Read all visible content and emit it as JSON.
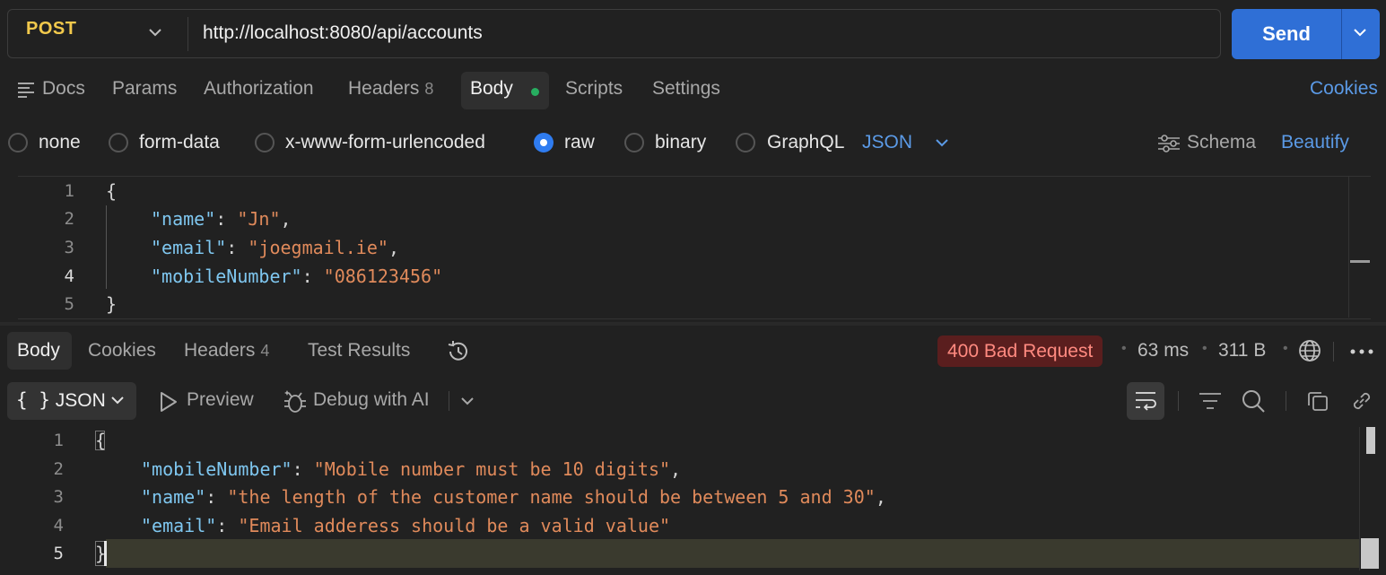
{
  "request": {
    "method": "POST",
    "url": "http://localhost:8080/api/accounts",
    "send_label": "Send"
  },
  "request_tabs": {
    "docs": "Docs",
    "params": "Params",
    "authorization": "Authorization",
    "headers": "Headers",
    "headers_count": "8",
    "body": "Body",
    "scripts": "Scripts",
    "settings": "Settings",
    "cookies": "Cookies"
  },
  "body_types": {
    "none": "none",
    "form_data": "form-data",
    "urlencoded": "x-www-form-urlencoded",
    "raw": "raw",
    "binary": "binary",
    "graphql": "GraphQL",
    "selected": "raw",
    "format": "JSON",
    "schema": "Schema",
    "beautify": "Beautify"
  },
  "request_body": {
    "line_numbers": [
      "1",
      "2",
      "3",
      "4",
      "5"
    ],
    "open": "{",
    "close": "}",
    "fields": [
      {
        "key": "\"name\"",
        "value": "\"Jn\"",
        "trail": ","
      },
      {
        "key": "\"email\"",
        "value": "\"joegmail.ie\"",
        "trail": ","
      },
      {
        "key": "\"mobileNumber\"",
        "value": "\"086123456\"",
        "trail": ""
      }
    ]
  },
  "response_tabs": {
    "body": "Body",
    "cookies": "Cookies",
    "headers": "Headers",
    "headers_count": "4",
    "test_results": "Test Results"
  },
  "response_meta": {
    "status": "400 Bad Request",
    "time": "63 ms",
    "size": "311 B"
  },
  "response_toolbar": {
    "format": "JSON",
    "preview": "Preview",
    "debug": "Debug with AI"
  },
  "response_body": {
    "line_numbers": [
      "1",
      "2",
      "3",
      "4",
      "5"
    ],
    "open": "{",
    "close": "}",
    "fields": [
      {
        "key": "\"mobileNumber\"",
        "value": "\"Mobile number must be 10 digits\"",
        "trail": ","
      },
      {
        "key": "\"name\"",
        "value": "\"the length of the customer name should be between 5 and 30\"",
        "trail": ","
      },
      {
        "key": "\"email\"",
        "value": "\"Email adderess should be a valid value\"",
        "trail": ""
      }
    ]
  },
  "colors": {
    "accent": "#2f6fd6",
    "method": "#f2c94c",
    "error_bg": "#5a1e1e",
    "error_text": "#ff8a80",
    "json_key": "#7fc7f0",
    "json_string": "#e08a5b"
  }
}
